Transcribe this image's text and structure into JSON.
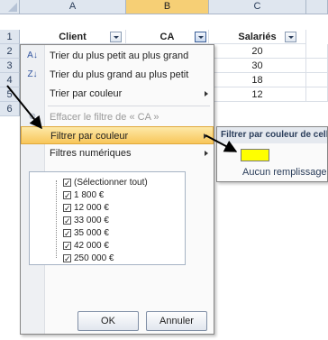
{
  "sheet": {
    "columns": [
      "A",
      "B",
      "C"
    ],
    "row_numbers": [
      "1",
      "2",
      "3",
      "4",
      "5",
      "6"
    ],
    "headers": {
      "a": "Client",
      "b": "CA",
      "c": "Salariés"
    },
    "c_values": [
      "20",
      "30",
      "18",
      "12"
    ]
  },
  "menu": {
    "sort_asc": "Trier du plus petit au plus grand",
    "sort_desc": "Trier du plus grand au plus petit",
    "sort_color": "Trier par couleur",
    "clear_filter": "Effacer le filtre de « CA »",
    "filter_color": "Filtrer par couleur",
    "number_filters": "Filtres numériques",
    "icons": {
      "sort_asc": "sort-ascending-icon",
      "sort_desc": "sort-descending-icon",
      "clear": "clear-filter-icon"
    }
  },
  "checklist": [
    "(Sélectionner tout)",
    "1 800 €",
    "12 000 €",
    "33 000 €",
    "35 000 €",
    "42 000 €",
    "250 000 €"
  ],
  "buttons": {
    "ok": "OK",
    "cancel": "Annuler"
  },
  "submenu": {
    "title": "Filtrer par couleur de cell",
    "swatch_color": "#ffff00",
    "no_fill": "Aucun remplissage"
  },
  "colors": {
    "highlight": "#f8c65a",
    "selected_column": "#f6cf75",
    "header_bg": "#dfe6ef"
  }
}
